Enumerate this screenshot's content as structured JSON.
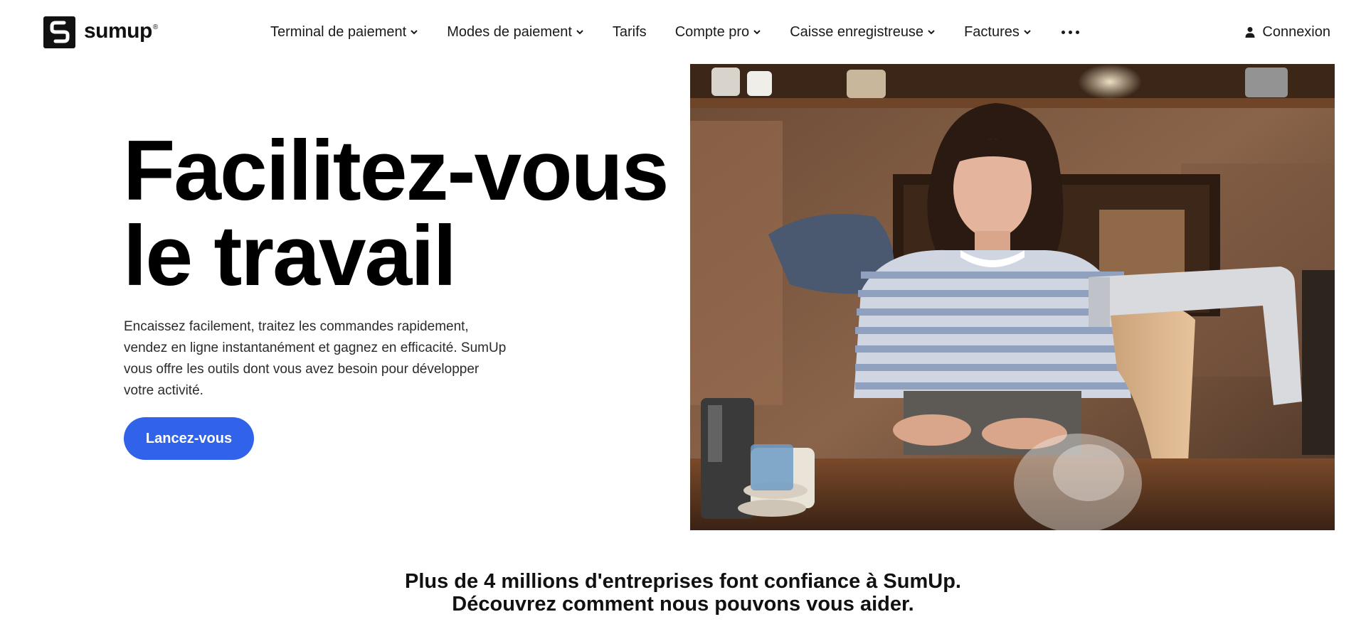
{
  "brand": {
    "name": "sumup",
    "registered_mark": "®",
    "logo_icon": "sumup-logo-icon"
  },
  "nav": {
    "items": [
      {
        "label": "Terminal de paiement",
        "has_dropdown": true
      },
      {
        "label": "Modes de paiement",
        "has_dropdown": true
      },
      {
        "label": "Tarifs",
        "has_dropdown": false
      },
      {
        "label": "Compte pro",
        "has_dropdown": true
      },
      {
        "label": "Caisse enregistreuse",
        "has_dropdown": true
      },
      {
        "label": "Factures",
        "has_dropdown": true
      }
    ],
    "more_icon": "more-dots-icon",
    "login_label": "Connexion",
    "login_icon": "user-icon"
  },
  "hero": {
    "title_line1": "Facilitez-vous",
    "title_line2": "le travail",
    "description": "Encaissez facilement, traitez les commandes rapidement, vendez en ligne instantanément et gagnez en efficacité. SumUp vous offre les outils dont vous avez besoin pour développer votre activité.",
    "cta_label": "Lancez-vous",
    "image": "cafe-owner-with-card-terminal-photo"
  },
  "trust": {
    "line1": "Plus de 4 millions d'entreprises font confiance à SumUp.",
    "line2": "Découvrez comment nous pouvons vous aider."
  },
  "colors": {
    "accent": "#3063e9",
    "text": "#1a1a1a",
    "background": "#ffffff"
  }
}
